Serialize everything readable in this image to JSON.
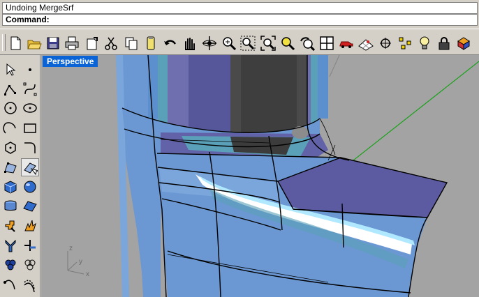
{
  "command_history": "Undoing MergeSrf",
  "command_prompt": "Command:",
  "viewport": {
    "title": "Perspective",
    "axis_x": "x",
    "axis_y": "y",
    "axis_z": "z"
  },
  "colors": {
    "viewport_bg": "#a3a3a3",
    "title_bg": "#0a64d6",
    "surface": "#6b98d3",
    "flange": "#5c5aa0"
  },
  "toolbar_icons": [
    "new-file-icon",
    "open-folder-icon",
    "save-icon",
    "print-icon",
    "import-icon",
    "cut-icon",
    "copy-icon",
    "paste-icon",
    "undo-icon",
    "pan-hand-icon",
    "rotate-view-icon",
    "zoom-dynamic-icon",
    "zoom-window-icon",
    "zoom-extents-icon",
    "zoom-selected-icon",
    "undo-view-icon",
    "four-viewports-icon",
    "car-icon",
    "grid-plane-icon",
    "object-snap-icon",
    "point-cloud-icon",
    "light-icon",
    "lock-icon",
    "render-icon"
  ],
  "sidebar_icons": [
    "select-arrow-icon",
    "point-icon",
    "polyline-icon",
    "control-point-curve-icon",
    "circle-icon",
    "ellipse-icon",
    "arc-icon",
    "rectangle-icon",
    "polygon-icon",
    "fillet-curve-icon",
    "surface-from-points-icon",
    "blend-surface-icon",
    "box-solid-icon",
    "sphere-solid-icon",
    "revolve-surface-icon",
    "surface-plane-icon",
    "boolean-union-icon",
    "explode-icon",
    "split-icon",
    "trim-icon",
    "spheres-group-icon",
    "circles-group-icon",
    "sweep-curve-icon",
    "sweep-path-icon"
  ]
}
